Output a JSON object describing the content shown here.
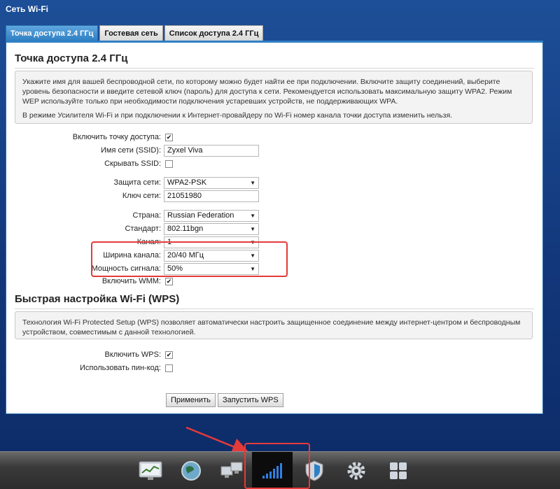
{
  "window": {
    "title": "Сеть Wi-Fi"
  },
  "tabs": [
    {
      "label": "Точка доступа 2.4 ГГц",
      "active": true
    },
    {
      "label": "Гостевая сеть",
      "active": false
    },
    {
      "label": "Список доступа 2.4 ГГц",
      "active": false
    }
  ],
  "access_point": {
    "title": "Точка доступа 2.4 ГГц",
    "info_paragraph1": "Укажите имя для вашей беспроводной сети, по которому можно будет найти ее при подключении. Включите защиту соединений, выберите уровень безопасности и введите сетевой ключ (пароль) для доступа к сети. Рекомендуется использовать максимальную защиту WPA2. Режим WEP используйте только при необходимости подключения устаревших устройств, не поддерживающих WPA.",
    "info_paragraph2": "В режиме Усилителя Wi-Fi и при подключении к Интернет-провайдеру по Wi-Fi номер канала точки доступа изменить нельзя.",
    "enable_ap_label": "Включить точку доступа:",
    "enable_ap_checked": "✔",
    "ssid_label": "Имя сети (SSID):",
    "ssid_value": "Zyxel Viva",
    "hide_ssid_label": "Скрывать SSID:",
    "hide_ssid_checked": "",
    "security_label": "Защита сети:",
    "security_value": "WPA2-PSK",
    "key_label": "Ключ сети:",
    "key_value": "21051980",
    "country_label": "Страна:",
    "country_value": "Russian Federation",
    "standard_label": "Стандарт:",
    "standard_value": "802.11bgn",
    "channel_label": "Канал:",
    "channel_value": "1",
    "width_label": "Ширина канала:",
    "width_value": "20/40 МГц",
    "power_label": "Мощность сигнала:",
    "power_value": "50%",
    "wmm_label": "Включить WMM:",
    "wmm_checked": "✔"
  },
  "wps": {
    "title": "Быстрая настройка Wi-Fi (WPS)",
    "info": "Технология Wi-Fi Protected Setup (WPS) позволяет автоматически настроить защищенное соединение между интернет-центром и беспроводным устройством, совместимым с данной технологией.",
    "enable_label": "Включить WPS:",
    "enable_checked": "✔",
    "pin_label": "Использовать пин-код:",
    "pin_checked": ""
  },
  "buttons": {
    "apply": "Применить",
    "start_wps": "Запустить WPS"
  },
  "taskbar": {
    "items": [
      {
        "icon": "monitor-chart-icon"
      },
      {
        "icon": "globe-icon"
      },
      {
        "icon": "network-computers-icon"
      },
      {
        "icon": "wifi-signal-bars-icon",
        "active": true
      },
      {
        "icon": "shield-icon"
      },
      {
        "icon": "gear-icon"
      },
      {
        "icon": "apps-grid-icon"
      }
    ]
  },
  "colors": {
    "accent": "#2f7fc4",
    "highlight": "#e53a3a",
    "background": "#1d4f98"
  }
}
